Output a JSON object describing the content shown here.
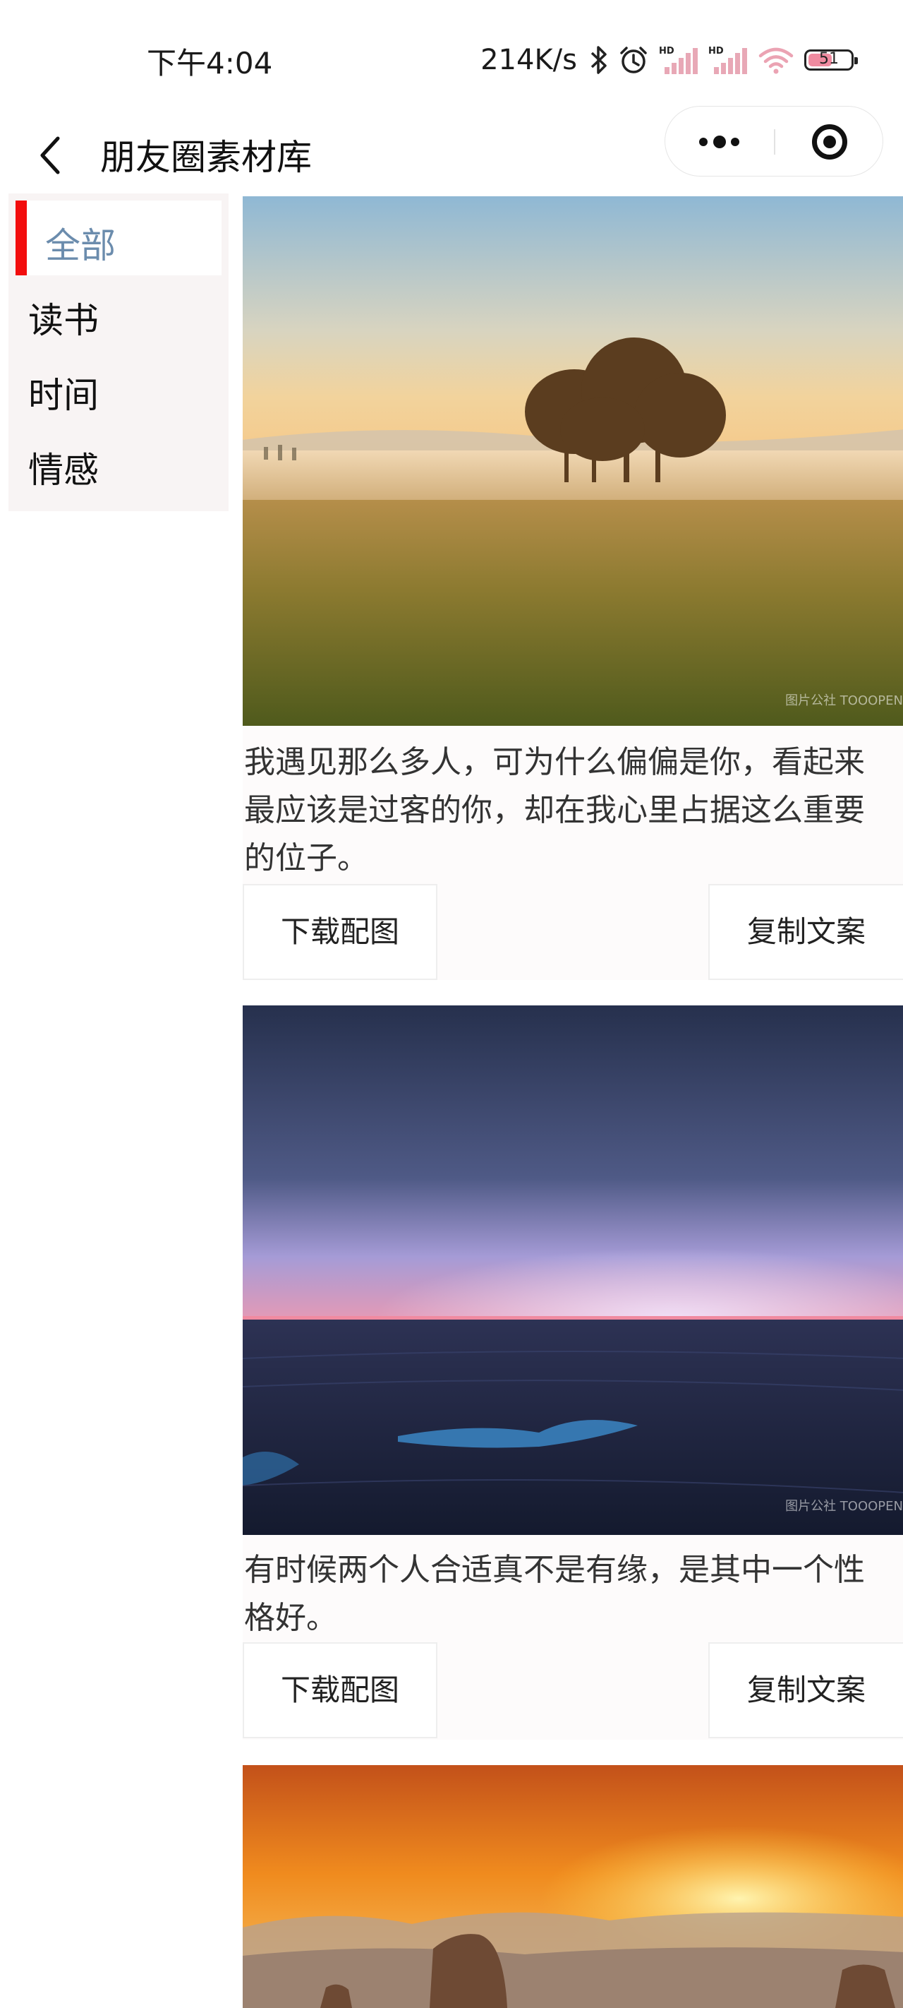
{
  "status_bar": {
    "time": "下午4:04",
    "net_speed": "214K/s",
    "battery_level": "51",
    "icons": [
      "bluetooth-icon",
      "alarm-icon",
      "hd-signal-icon",
      "hd-signal-icon",
      "wifi-icon",
      "battery-icon"
    ]
  },
  "nav": {
    "title": "朋友圈素材库",
    "back_icon": "chevron-left-icon",
    "more_icon": "more-dots-icon",
    "close_icon": "record-target-icon"
  },
  "categories": [
    {
      "label": "全部",
      "active": true
    },
    {
      "label": "读书",
      "active": false
    },
    {
      "label": "时间",
      "active": false
    },
    {
      "label": "情感",
      "active": false
    }
  ],
  "colors": {
    "active_indicator": "#f20d0d",
    "active_text": "#6b8cad",
    "sidebar_bg": "#f8f4f4"
  },
  "posts": [
    {
      "image": "misty-meadow-trees",
      "watermark": "图片公社 TOOOPEN",
      "text": "我遇见那么多人，可为什么偏偏是你，看起来最应该是过客的你，却在我心里占据这么重要的位子。",
      "download_label": "下载配图",
      "copy_label": "复制文案"
    },
    {
      "image": "night-sea-horizon",
      "watermark": "图片公社 TOOOPEN",
      "text": "有时候两个人合适真不是有缘，是其中一个性格好。",
      "download_label": "下载配图",
      "copy_label": "复制文案"
    },
    {
      "image": "sunset-rock-pillars"
    }
  ]
}
